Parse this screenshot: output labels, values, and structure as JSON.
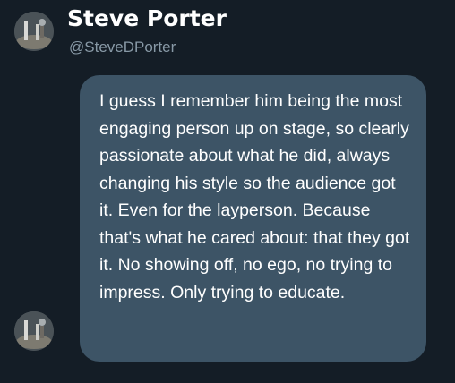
{
  "profile": {
    "display_name": "Steve Porter",
    "handle": "@SteveDPorter",
    "avatar_icon": "user-avatar-photo"
  },
  "message": {
    "text": "I guess I remember him being the most engaging person up on stage, so clearly passionate about what he did, always changing his style so the audience got it. Even for the layperson. Because that's what he cared about: that they got it. No showing off, no ego, no trying to impress. Only trying to educate."
  },
  "colors": {
    "background": "#141d26",
    "bubble": "#3d5466",
    "handle": "#8899a6",
    "text": "#ffffff"
  }
}
